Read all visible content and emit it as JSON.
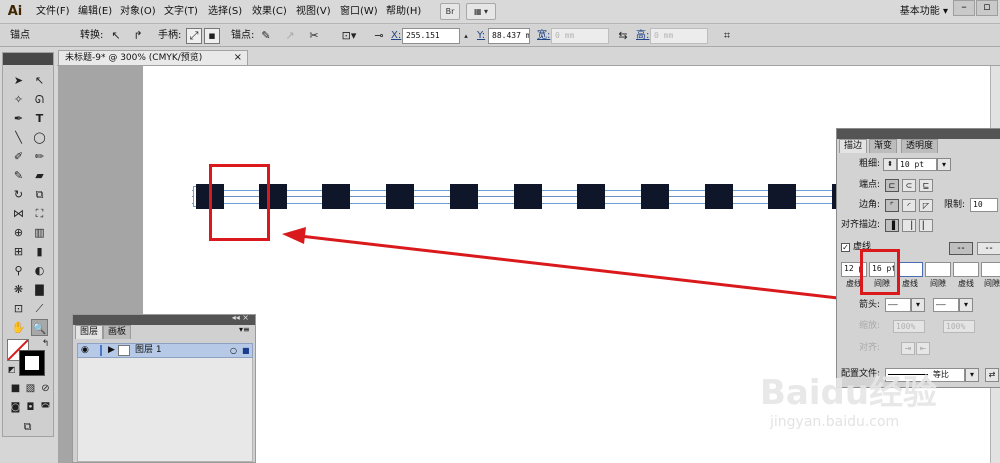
{
  "app": {
    "logo": "Ai"
  },
  "menubar": {
    "items": [
      "文件(F)",
      "编辑(E)",
      "对象(O)",
      "文字(T)",
      "选择(S)",
      "效果(C)",
      "视图(V)",
      "窗口(W)",
      "帮助(H)"
    ],
    "bridge_label": "Br",
    "workspace": "基本功能",
    "workspace_arrow": "▾"
  },
  "controlbar": {
    "anchor_label": "锚点",
    "convert_label": "转换:",
    "handle_label": "手柄:",
    "anchor_points_label": "锚点:",
    "x_label": "X:",
    "x_value": "255.151",
    "y_label": "Y:",
    "y_value": "88.437 m",
    "w_label": "宽:",
    "w_value": "0 mm",
    "h_label": "高:",
    "h_value": "0 mm"
  },
  "document": {
    "tab_title": "未标题-9* @ 300% (CMYK/预览)",
    "close": "×"
  },
  "layers_panel": {
    "tabs": [
      "图层",
      "画板"
    ],
    "layer_name": "图层 1"
  },
  "stroke_panel": {
    "tabs": [
      "描边",
      "渐变",
      "透明度"
    ],
    "weight_label": "粗细:",
    "weight_value": "10 pt",
    "cap_label": "端点:",
    "corner_label": "边角:",
    "limit_label": "限制:",
    "limit_value": "10",
    "align_label": "对齐描边:",
    "dashed_label": "虚线",
    "dash_values": [
      "12 p",
      "16 pt",
      "",
      "",
      "",
      ""
    ],
    "dash_labels": [
      "虚线",
      "间隙",
      "虚线",
      "间隙",
      "虚线",
      "间隙"
    ],
    "arrow_label": "箭头:",
    "scale_label": "缩放:",
    "scale_values": [
      "100%",
      "100%"
    ],
    "align_arrow_label": "对齐:",
    "profile_label": "配置文件:",
    "profile_value": "等比"
  },
  "colors": {
    "annotation": "#d9191b",
    "dash_fill": "#10162a",
    "guide": "#6f9fd8"
  },
  "watermark": {
    "brand": "Baidu经验",
    "url": "jingyan.baidu.com"
  }
}
